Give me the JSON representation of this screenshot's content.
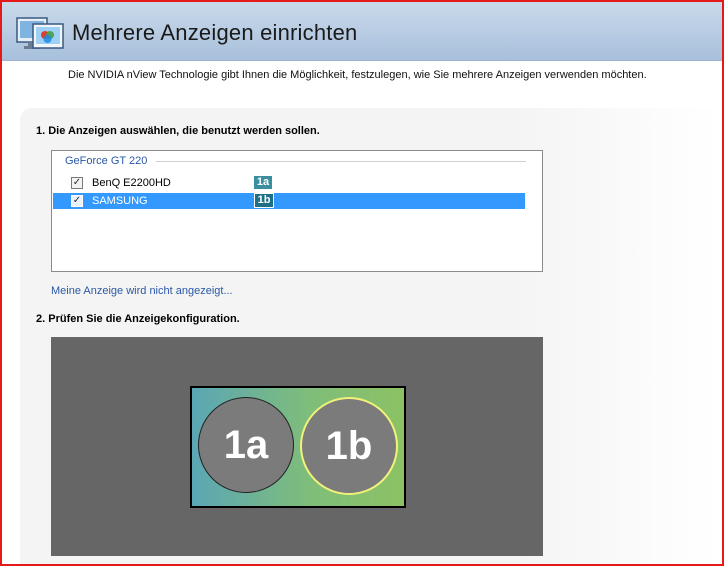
{
  "header": {
    "title": "Mehrere Anzeigen einrichten"
  },
  "description": "Die NVIDIA nView Technologie gibt Ihnen die Möglichkeit, festzulegen, wie Sie mehrere Anzeigen verwenden möchten.",
  "step1": {
    "heading": "1. Die Anzeigen auswählen, die benutzt werden sollen.",
    "gpu": "GeForce GT 220",
    "displays": [
      {
        "name": "BenQ E2200HD",
        "checked": true,
        "badge": "1a",
        "selected": false
      },
      {
        "name": "SAMSUNG",
        "checked": true,
        "badge": "1b",
        "selected": true
      }
    ],
    "missing_link": "Meine Anzeige wird nicht angezeigt..."
  },
  "step2": {
    "heading": "2. Prüfen Sie die Anzeigekonfiguration.",
    "preview": [
      {
        "label": "1a"
      },
      {
        "label": "1b"
      }
    ]
  },
  "colors": {
    "header_bg": "#a8c0dc",
    "selection": "#3399ff",
    "link": "#2a58a8",
    "badge": "#3b8ea0",
    "preview_bg": "#666666",
    "frame": "#e41a1a"
  },
  "icons": {
    "header": "multi-monitor-icon"
  }
}
